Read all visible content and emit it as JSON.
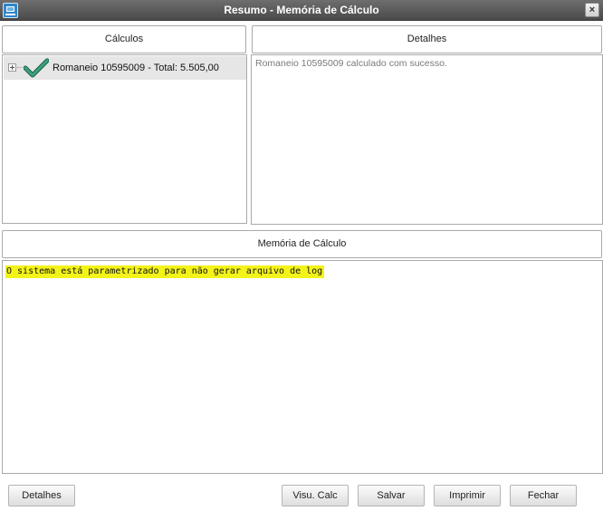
{
  "window": {
    "title": "Resumo - Memória de Cálculo",
    "close_label": "×"
  },
  "calculos": {
    "header": "Cálculos",
    "items": [
      {
        "label": "Romaneio 10595009 - Total: 5.505,00",
        "status_icon": "check-icon",
        "expanded": false
      }
    ]
  },
  "detalhes": {
    "header": "Detalhes",
    "text": "Romaneio 10595009 calculado com sucesso."
  },
  "memoria": {
    "header": "Memória de Cálculo",
    "text": "O sistema está parametrizado para não gerar arquivo de log",
    "highlight_color": "#f3f31a"
  },
  "buttons": {
    "detalhes": "Detalhes",
    "visu_calc": "Visu. Calc",
    "salvar": "Salvar",
    "imprimir": "Imprimir",
    "fechar": "Fechar"
  },
  "colors": {
    "titlebar": "#555555",
    "check": "#2f8f6a",
    "selected_row": "#e6e6e6"
  }
}
